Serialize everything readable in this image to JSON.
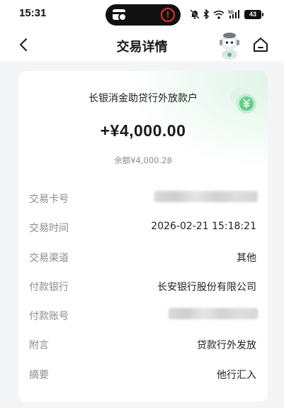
{
  "status_bar": {
    "time": "15:31",
    "battery": "43"
  },
  "nav": {
    "title": "交易详情"
  },
  "transaction": {
    "payee": "长银消金助贷行外放款户",
    "amount": "+¥4,000.00",
    "balance": "余额¥4,000.28"
  },
  "details": {
    "card_label": "交易卡号",
    "time_label": "交易时间",
    "time_value": "2026-02-21 15:18:21",
    "channel_label": "交易渠道",
    "channel_value": "其他",
    "bank_label": "付款银行",
    "bank_value": "长安银行股份有限公司",
    "account_label": "付款账号",
    "memo_label": "附言",
    "memo_value": "贷款行外发放",
    "summary_label": "摘要",
    "summary_value": "他行汇入"
  },
  "colors": {
    "alert": "#e4332b",
    "accent_green": "#4ccb7a",
    "background": "#f4f5f7"
  },
  "icons": {
    "back": "chevron-left-icon",
    "home": "home-icon",
    "assistant": "robot-assistant-icon",
    "badge": "yen-badge-icon"
  }
}
